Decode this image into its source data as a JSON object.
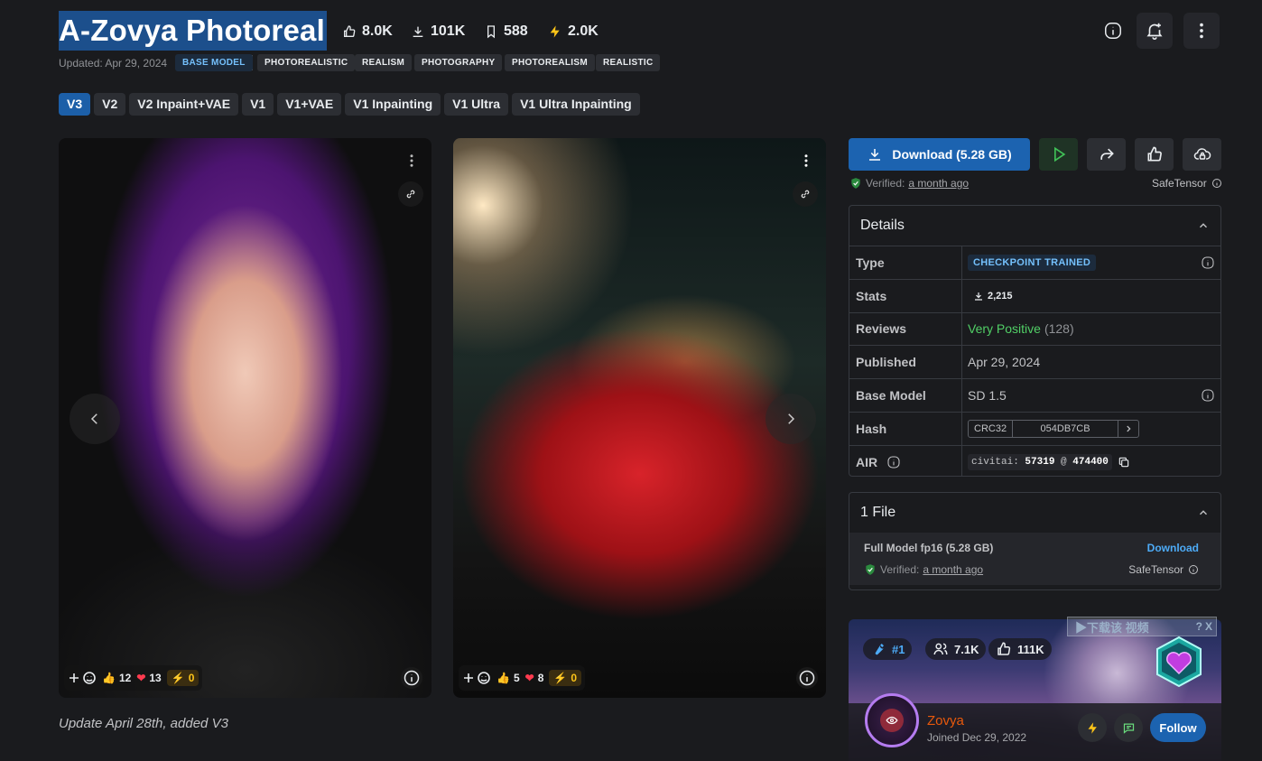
{
  "header": {
    "title": "A-Zovya Photoreal",
    "stats": {
      "likes": "8.0K",
      "downloads": "101K",
      "collects": "588",
      "buzz": "2.0K"
    },
    "updated": "Updated: Apr 29, 2024",
    "tags": [
      "BASE MODEL",
      "PHOTOREALISTIC",
      "REALISM",
      "PHOTOGRAPHY",
      "PHOTOREALISM",
      "REALISTIC"
    ]
  },
  "versions": [
    "V3",
    "V2",
    "V2 Inpaint+VAE",
    "V1",
    "V1+VAE",
    "V1 Inpainting",
    "V1 Ultra",
    "V1 Ultra Inpainting"
  ],
  "gallery": [
    {
      "likes": "12",
      "hearts": "13",
      "buzz": "0"
    },
    {
      "likes": "5",
      "hearts": "8",
      "buzz": "0"
    }
  ],
  "caption": "Update April 28th, added V3",
  "download": {
    "label": "Download (5.28 GB)",
    "verified_label": "Verified:",
    "verified_when": "a month ago",
    "safetensor": "SafeTensor"
  },
  "details": {
    "title": "Details",
    "type_label": "Type",
    "type_value": "CHECKPOINT TRAINED",
    "stats_label": "Stats",
    "stats_value": "2,215",
    "reviews_label": "Reviews",
    "reviews_value": "Very Positive",
    "reviews_count": "(128)",
    "published_label": "Published",
    "published_value": "Apr 29, 2024",
    "base_label": "Base Model",
    "base_value": "SD 1.5",
    "hash_label": "Hash",
    "hash_type": "CRC32",
    "hash_value": "054DB7CB",
    "air_label": "AIR",
    "air_prefix": "civitai:",
    "air_model": "57319",
    "air_at": "@",
    "air_version": "474400"
  },
  "files": {
    "title": "1 File",
    "name": "Full Model fp16 (5.28 GB)",
    "download_label": "Download",
    "verified_label": "Verified:",
    "verified_when": "a month ago",
    "safetensor": "SafeTensor"
  },
  "creator": {
    "rank": "#1",
    "followers": "7.1K",
    "likes": "111K",
    "name": "Zovya",
    "joined": "Joined Dec 29, 2022",
    "follow_label": "Follow"
  },
  "overlay": {
    "text": "▶下载该 视频",
    "help": "?",
    "close": "X"
  },
  "colors": {
    "accent": "#1c63b0",
    "buzz": "#fcc419",
    "positive": "#51cf66",
    "creator_name": "#e8590c"
  }
}
